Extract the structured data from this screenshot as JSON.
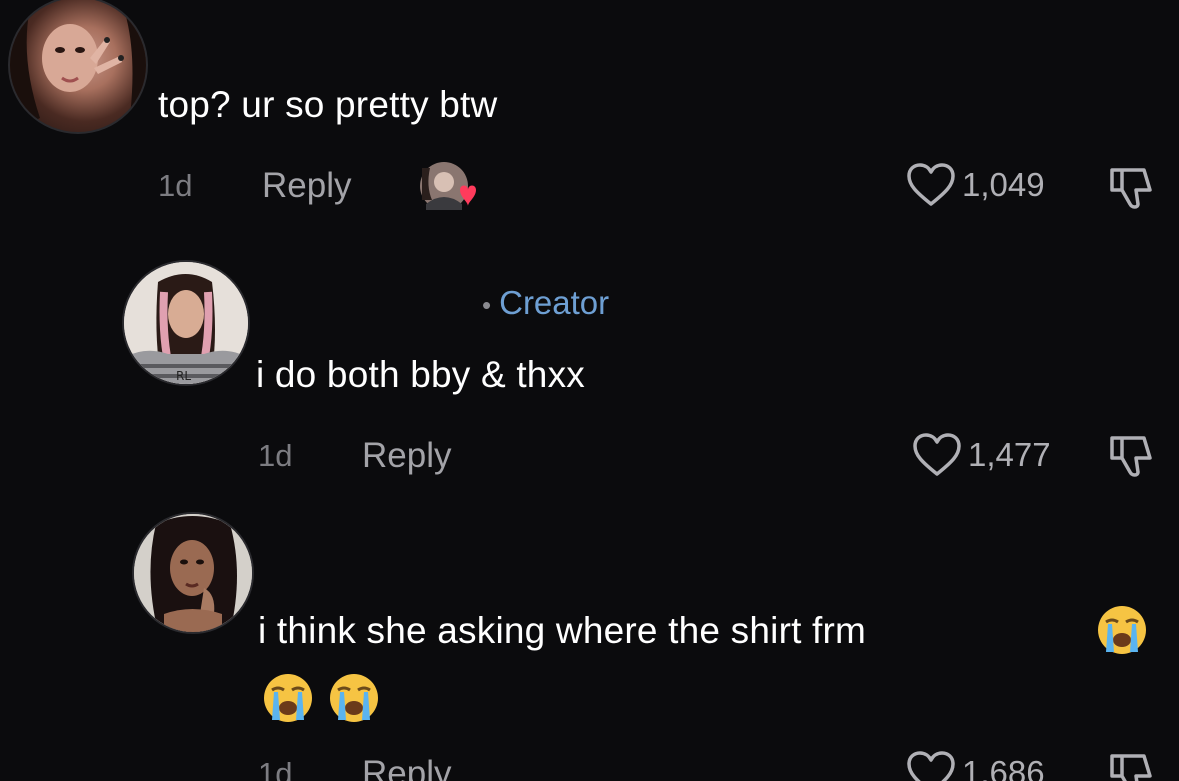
{
  "comments": [
    {
      "text": "top? ur so pretty btw",
      "time": "1d",
      "reply_label": "Reply",
      "likes": "1,049",
      "liked_by_creator": true
    },
    {
      "creator_label": "Creator",
      "text": "i do both bby & thxx",
      "time": "1d",
      "reply_label": "Reply",
      "likes": "1,477"
    },
    {
      "text": "i think she asking where the shirt frm",
      "emoji": "loudly-crying-face",
      "emoji_count": 3,
      "time": "1d",
      "reply_label": "Reply",
      "likes": "1,686"
    }
  ],
  "colors": {
    "background": "#0b0b0d",
    "text": "#ffffff",
    "muted": "#7d7d82",
    "creator": "#6e9fd3",
    "heart_badge": "#ff3b5c"
  }
}
